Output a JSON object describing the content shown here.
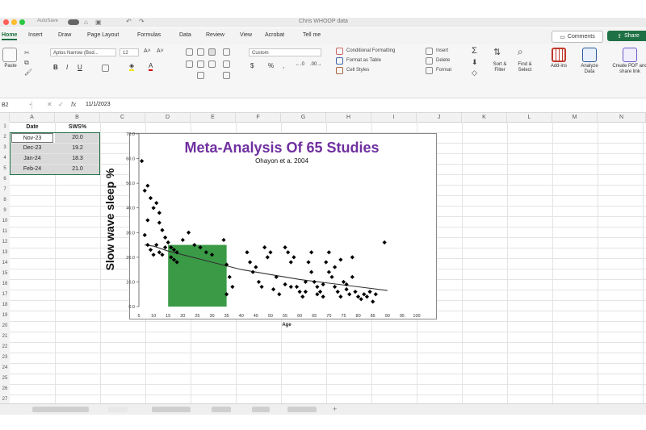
{
  "window": {
    "title": "Chris WHOOP data",
    "autosave": "AutoSave"
  },
  "tabs": [
    "Home",
    "Insert",
    "Draw",
    "Page Layout",
    "Formulas",
    "Data",
    "Review",
    "View",
    "Acrobat",
    "Tell me"
  ],
  "active_tab": "Home",
  "header_buttons": {
    "comments": "Comments",
    "share": "Share"
  },
  "ribbon": {
    "paste": "Paste",
    "font_name": "Aptos Narrow (Bod...",
    "font_size": "12",
    "number_format": "Custom",
    "conditional_formatting": "Conditional Formatting",
    "format_as_table": "Format as Table",
    "cell_styles": "Cell Styles",
    "insert": "Insert",
    "delete": "Delete",
    "format": "Format",
    "sort_filter": "Sort & Filter",
    "find_select": "Find & Select",
    "add_ins": "Add-ins",
    "analyze_data": "Analyze Data",
    "create_pdf": "Create PDF and share link",
    "currency_symbol": "$",
    "percent_symbol": "%",
    "sum_symbol": "Σ"
  },
  "formula_bar": {
    "name_box": "B2",
    "fx": "fx",
    "value": "11/1/2023"
  },
  "columns": [
    "A",
    "B",
    "C",
    "D",
    "E",
    "F",
    "G",
    "H",
    "I",
    "J",
    "K",
    "L",
    "M",
    "N"
  ],
  "rows": [
    "1",
    "2",
    "3",
    "4",
    "5",
    "6",
    "7",
    "8",
    "9",
    "10",
    "11",
    "12",
    "13",
    "14",
    "15",
    "16",
    "17",
    "18",
    "19",
    "20",
    "21",
    "22",
    "23",
    "24",
    "25",
    "26",
    "27"
  ],
  "table": {
    "headers": [
      "Date",
      "SWS%"
    ],
    "rows": [
      [
        "Nov-23",
        "20.0"
      ],
      [
        "Dec-23",
        "19.2"
      ],
      [
        "Jan-24",
        "18.3"
      ],
      [
        "Feb-24",
        "21.0"
      ]
    ]
  },
  "colors": {
    "excel_green": "#1e7145",
    "title_purple": "#7030a0",
    "highlight_green": "#3a9a46",
    "cell_gray": "#d9d9d9"
  },
  "chart_data": {
    "type": "scatter",
    "title": "Meta-Analysis Of 65 Studies",
    "subtitle": "Ohayon et a. 2004",
    "xlabel": "Age",
    "ylabel": "Slow wave sleep %",
    "xlim": [
      5,
      100
    ],
    "ylim": [
      0,
      70
    ],
    "x_ticks": [
      "5",
      "10",
      "15",
      "20",
      "25",
      "30",
      "35",
      "40",
      "45",
      "50",
      "55",
      "60",
      "65",
      "70",
      "75",
      "80",
      "85",
      "90",
      "95",
      "100"
    ],
    "y_ticks": [
      "0.0",
      "10.0",
      "20.0",
      "30.0",
      "40.0",
      "50.0",
      "60.0",
      "70.0"
    ],
    "grid": false,
    "highlight_region": {
      "x_range": [
        15,
        35
      ],
      "y_range": [
        0,
        25
      ]
    },
    "trendline": [
      [
        7,
        25
      ],
      [
        10,
        24.5
      ],
      [
        15,
        22.5
      ],
      [
        20,
        21
      ],
      [
        30,
        18
      ],
      [
        40,
        15
      ],
      [
        50,
        13
      ],
      [
        60,
        11
      ],
      [
        70,
        9.5
      ],
      [
        80,
        8
      ],
      [
        90,
        6.5
      ]
    ],
    "points": [
      [
        6,
        59
      ],
      [
        7,
        47
      ],
      [
        8,
        49
      ],
      [
        9,
        44
      ],
      [
        10,
        40
      ],
      [
        11,
        42
      ],
      [
        12,
        38
      ],
      [
        12,
        34
      ],
      [
        13,
        31
      ],
      [
        14,
        28
      ],
      [
        11,
        25
      ],
      [
        12,
        22
      ],
      [
        13,
        21
      ],
      [
        14,
        24
      ],
      [
        15,
        26
      ],
      [
        16,
        24
      ],
      [
        17,
        23
      ],
      [
        18,
        22
      ],
      [
        8,
        25
      ],
      [
        9,
        23
      ],
      [
        10,
        21
      ],
      [
        7,
        29
      ],
      [
        8,
        35
      ],
      [
        16,
        20
      ],
      [
        17,
        19
      ],
      [
        18,
        18
      ],
      [
        20,
        27
      ],
      [
        22,
        30
      ],
      [
        24,
        25
      ],
      [
        26,
        24
      ],
      [
        28,
        22
      ],
      [
        30,
        21
      ],
      [
        34,
        27
      ],
      [
        35,
        17
      ],
      [
        36,
        12
      ],
      [
        37,
        8
      ],
      [
        35,
        5
      ],
      [
        42,
        22
      ],
      [
        43,
        18
      ],
      [
        44,
        14
      ],
      [
        45,
        16
      ],
      [
        46,
        10
      ],
      [
        47,
        8
      ],
      [
        48,
        24
      ],
      [
        49,
        20
      ],
      [
        50,
        22
      ],
      [
        51,
        7
      ],
      [
        52,
        12
      ],
      [
        53,
        5
      ],
      [
        55,
        24
      ],
      [
        56,
        22
      ],
      [
        57,
        18
      ],
      [
        58,
        20
      ],
      [
        59,
        8
      ],
      [
        60,
        6
      ],
      [
        61,
        4
      ],
      [
        62,
        6
      ],
      [
        63,
        18
      ],
      [
        64,
        22
      ],
      [
        65,
        10
      ],
      [
        66,
        8
      ],
      [
        67,
        6
      ],
      [
        68,
        4
      ],
      [
        69,
        18
      ],
      [
        70,
        14
      ],
      [
        71,
        12
      ],
      [
        72,
        8
      ],
      [
        73,
        6
      ],
      [
        74,
        19
      ],
      [
        75,
        10
      ],
      [
        76,
        7
      ],
      [
        77,
        5
      ],
      [
        78,
        20
      ],
      [
        79,
        6
      ],
      [
        80,
        4
      ],
      [
        81,
        3
      ],
      [
        82,
        5
      ],
      [
        83,
        4
      ],
      [
        84,
        6
      ],
      [
        85,
        2
      ],
      [
        86,
        5
      ],
      [
        89,
        26
      ],
      [
        55,
        9
      ],
      [
        57,
        8
      ],
      [
        62,
        10
      ],
      [
        64,
        14
      ],
      [
        66,
        5
      ],
      [
        68,
        9
      ],
      [
        70,
        22
      ],
      [
        72,
        16
      ],
      [
        74,
        4
      ],
      [
        76,
        9
      ],
      [
        78,
        12
      ]
    ]
  }
}
